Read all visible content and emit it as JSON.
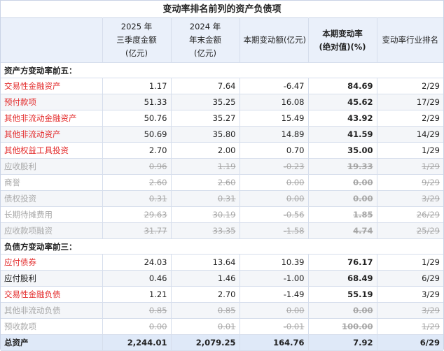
{
  "title": "变动率排名前列的资产负债项",
  "header": {
    "col_name": "",
    "col_q3_line1": "2025 年",
    "col_q3_line2": "三季度金额",
    "col_q3_line3": "(亿元)",
    "col_ye_line1": "2024 年",
    "col_ye_line2": "年末金额",
    "col_ye_line3": "(亿元)",
    "col_change": "本期变动额(亿元)",
    "col_rate_line1": "本期变动率",
    "col_rate_line2": "(绝对值)(%)",
    "col_rank": "变动率行业排名"
  },
  "assets_section": "资产方变动率前五：",
  "assets": [
    {
      "name": "交易性金融资产",
      "q3": "1.17",
      "ye": "7.64",
      "change": "-6.47",
      "rate": "84.69",
      "rank": "2/29",
      "red": true,
      "muted": false
    },
    {
      "name": "预付款项",
      "q3": "51.33",
      "ye": "35.25",
      "change": "16.08",
      "rate": "45.62",
      "rank": "17/29",
      "red": true,
      "muted": false
    },
    {
      "name": "其他非流动金融资产",
      "q3": "50.76",
      "ye": "35.27",
      "change": "15.49",
      "rate": "43.92",
      "rank": "2/29",
      "red": true,
      "muted": false
    },
    {
      "name": "其他非流动资产",
      "q3": "50.69",
      "ye": "35.80",
      "change": "14.89",
      "rate": "41.59",
      "rank": "14/29",
      "red": true,
      "muted": false
    },
    {
      "name": "其他权益工具投资",
      "q3": "2.70",
      "ye": "2.00",
      "change": "0.70",
      "rate": "35.00",
      "rank": "1/29",
      "red": true,
      "muted": false
    },
    {
      "name": "应收股利",
      "q3": "0.96",
      "ye": "1.19",
      "change": "-0.23",
      "rate": "19.33",
      "rank": "1/29",
      "red": false,
      "muted": true
    },
    {
      "name": "商誉",
      "q3": "2.60",
      "ye": "2.60",
      "change": "0.00",
      "rate": "0.00",
      "rank": "9/29",
      "red": false,
      "muted": true
    },
    {
      "name": "债权投资",
      "q3": "0.31",
      "ye": "0.31",
      "change": "0.00",
      "rate": "0.00",
      "rank": "3/29",
      "red": false,
      "muted": true
    },
    {
      "name": "长期待摊费用",
      "q3": "29.63",
      "ye": "30.19",
      "change": "-0.56",
      "rate": "1.85",
      "rank": "26/29",
      "red": false,
      "muted": true
    },
    {
      "name": "应收款项融资",
      "q3": "31.77",
      "ye": "33.35",
      "change": "-1.58",
      "rate": "4.74",
      "rank": "25/29",
      "red": false,
      "muted": true
    }
  ],
  "liabilities_section": "负债方变动率前三：",
  "liabilities": [
    {
      "name": "应付债券",
      "q3": "24.03",
      "ye": "13.64",
      "change": "10.39",
      "rate": "76.17",
      "rank": "1/29",
      "red": true,
      "muted": false
    },
    {
      "name": "应付股利",
      "q3": "0.46",
      "ye": "1.46",
      "change": "-1.00",
      "rate": "68.49",
      "rank": "6/29",
      "red": false,
      "muted": false
    },
    {
      "name": "交易性金融负债",
      "q3": "1.21",
      "ye": "2.70",
      "change": "-1.49",
      "rate": "55.19",
      "rank": "3/29",
      "red": true,
      "muted": false
    },
    {
      "name": "其他非流动负债",
      "q3": "0.85",
      "ye": "0.85",
      "change": "0.00",
      "rate": "0.00",
      "rank": "3/29",
      "red": false,
      "muted": true
    },
    {
      "name": "预收款项",
      "q3": "0.00",
      "ye": "0.01",
      "change": "-0.01",
      "rate": "100.00",
      "rank": "1/29",
      "red": false,
      "muted": true
    }
  ],
  "total": {
    "name": "总资产",
    "q3": "2,244.01",
    "ye": "2,079.25",
    "change": "164.76",
    "rate": "7.92",
    "rank": "6/29"
  },
  "colors": {
    "red_text": "#e32b2b",
    "header_bg": "#eaf0fa",
    "total_bg": "#dfe9f8",
    "muted_text": "#a9a9a9"
  }
}
